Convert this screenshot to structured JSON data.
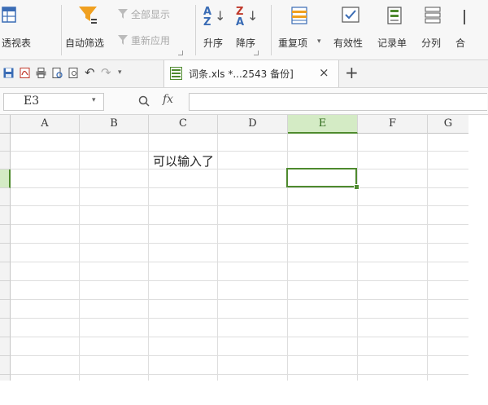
{
  "ribbon": {
    "pivot_label": "透视表",
    "autofilter_label": "自动筛选",
    "show_all_label": "全部显示",
    "reapply_label": "重新应用",
    "sort_asc_label": "升序",
    "sort_desc_label": "降序",
    "duplicates_label": "重复项",
    "validation_label": "有效性",
    "record_form_label": "记录单",
    "split_label": "分列",
    "merge_label": "合"
  },
  "tabbar": {
    "file_tab_label": "词条.xls *...2543 备份]",
    "close_glyph": "×",
    "new_tab_glyph": "+"
  },
  "formula_bar": {
    "name_box": "E3",
    "zoom_glyph": "Q",
    "fx_label": "fx",
    "formula_value": ""
  },
  "grid": {
    "columns": [
      "A",
      "B",
      "C",
      "D",
      "E",
      "F",
      "G"
    ],
    "active_column": "E",
    "active_cell": "E3",
    "cells": {
      "C2": "可以输入了"
    }
  },
  "colors": {
    "accent_green": "#4e8a2e",
    "active_header_bg": "#d4ebc5",
    "icon_blue": "#3a6cb5",
    "filter_orange": "#f0a020"
  }
}
